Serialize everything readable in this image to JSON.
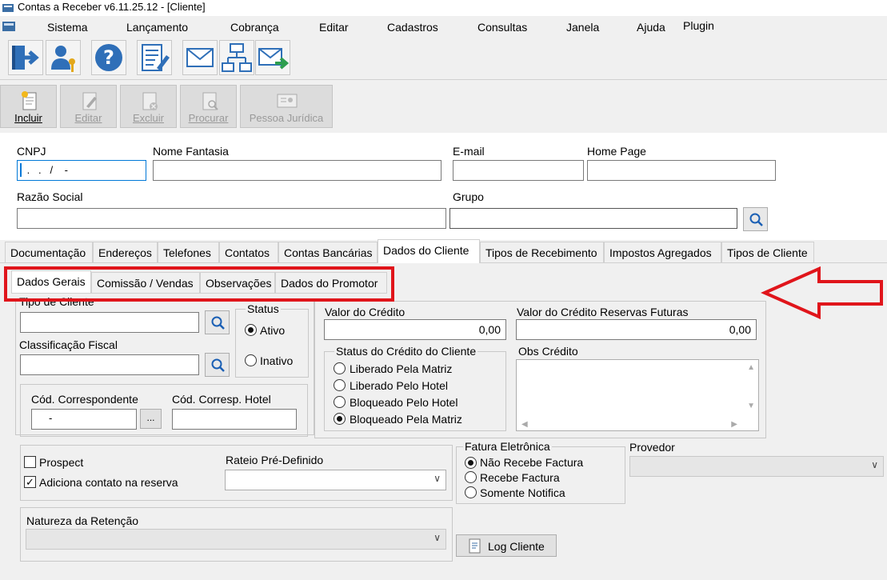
{
  "window": {
    "title": "Contas a Receber v6.11.25.12 - [Cliente]"
  },
  "menu": [
    "Sistema",
    "Lançamento",
    "Cobrança",
    "Editar",
    "Cadastros",
    "Consultas",
    "Janela",
    "Ajuda",
    "Plugin"
  ],
  "toolbar_icons": [
    "exit-icon",
    "user-key-icon",
    "help-icon",
    "document-edit-icon",
    "mail-icon",
    "org-chart-icon",
    "mail-forward-icon"
  ],
  "actions": {
    "incluir": "Incluir",
    "editar": "Editar",
    "excluir": "Excluir",
    "procurar": "Procurar",
    "pessoa_juridica": "Pessoa Jurídica"
  },
  "form": {
    "cnpj_label": "CNPJ",
    "cnpj_value": " .   .   /    -",
    "nome_fantasia_label": "Nome Fantasia",
    "email_label": "E-mail",
    "home_page_label": "Home Page",
    "razao_social_label": "Razão Social",
    "grupo_label": "Grupo"
  },
  "tabs": [
    "Documentação",
    "Endereços",
    "Telefones",
    "Contatos",
    "Contas Bancárias",
    "Dados do Cliente",
    "Tipos de Recebimento",
    "Impostos Agregados",
    "Tipos de Cliente"
  ],
  "active_tab": "Dados do Cliente",
  "subtabs": [
    "Dados Gerais",
    "Comissão / Vendas",
    "Observações",
    "Dados do Promotor"
  ],
  "active_subtab": "Dados Gerais",
  "dados_gerais": {
    "tipo_cliente_label": "Tipo de Cliente",
    "classificacao_fiscal_label": "Classificação Fiscal",
    "status_title": "Status",
    "status_ativo": "Ativo",
    "status_inativo": "Inativo",
    "status_selected": "Ativo",
    "cod_correspondente_label": "Cód. Correspondente",
    "cod_correspondente_value": "-",
    "cod_hotel_label": "Cód. Corresp. Hotel",
    "ellipsis_label": "...",
    "valor_credito_label": "Valor do Crédito",
    "valor_credito_value": "0,00",
    "valor_reservas_label": "Valor do Crédito Reservas Futuras",
    "valor_reservas_value": "0,00",
    "status_credito_title": "Status do Crédito do Cliente",
    "status_credito_options": [
      "Liberado Pela Matriz",
      "Liberado Pelo Hotel",
      "Bloqueado Pelo Hotel",
      "Bloqueado Pela Matriz"
    ],
    "status_credito_selected": "Bloqueado Pela Matriz",
    "obs_credito_label": "Obs Crédito",
    "prospect_label": "Prospect",
    "prospect_checked": false,
    "adiciona_contato_label": "Adiciona contato na reserva",
    "adiciona_contato_checked": true,
    "rateio_label": "Rateio Pré-Definido",
    "fatura_title": "Fatura Eletrônica",
    "fatura_options": [
      "Não Recebe Factura",
      "Recebe Factura",
      "Somente Notifica"
    ],
    "fatura_selected": "Não Recebe Factura",
    "provedor_label": "Provedor",
    "natureza_label": "Natureza da Retenção",
    "log_cliente_label": "Log Cliente"
  },
  "annotation_color": "#e0151b"
}
